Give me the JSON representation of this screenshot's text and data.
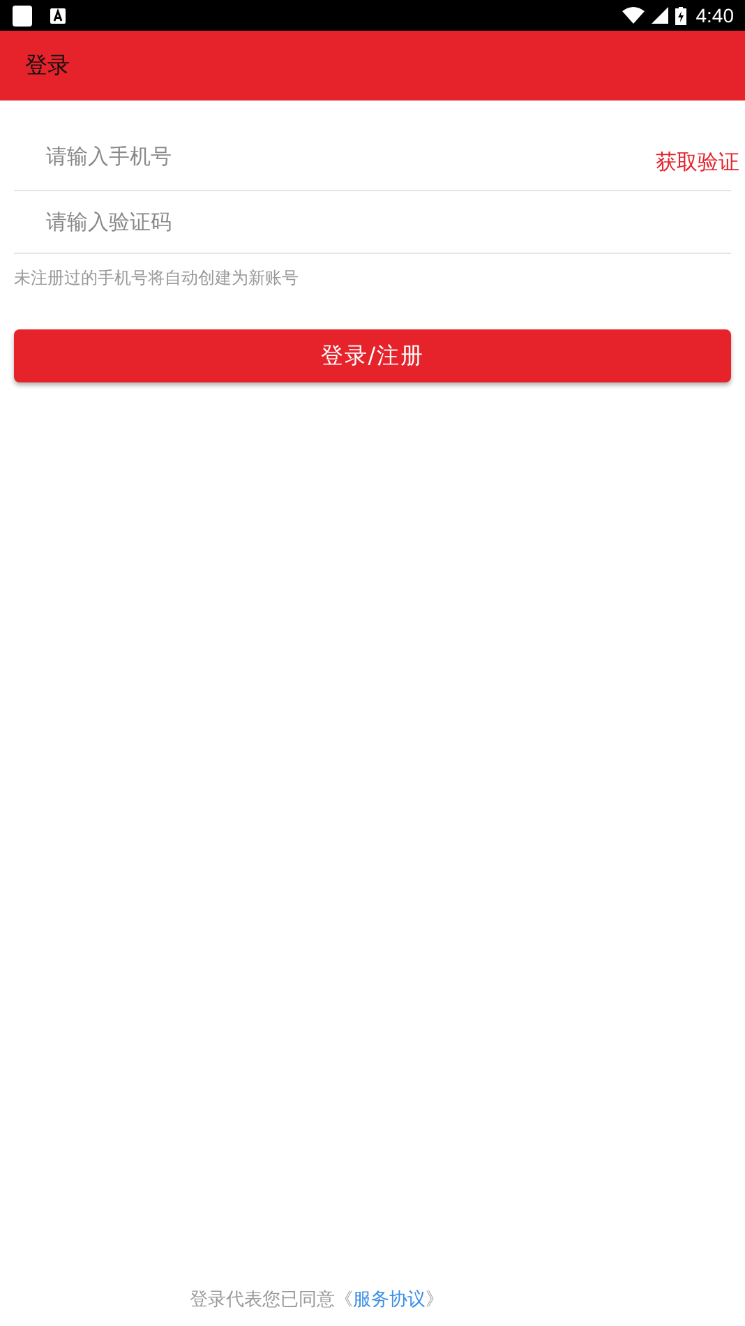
{
  "status_bar": {
    "time": "4:40"
  },
  "app_bar": {
    "title": "登录"
  },
  "phone_field": {
    "placeholder": "请输入手机号"
  },
  "get_code_button": {
    "label": "获取验证"
  },
  "code_field": {
    "placeholder": "请输入验证码"
  },
  "hint": "未注册过的手机号将自动创建为新账号",
  "submit_button": {
    "label": "登录/注册"
  },
  "agreement": {
    "before": "登录代表您已同意《",
    "link": "服务协议",
    "after": "》"
  }
}
